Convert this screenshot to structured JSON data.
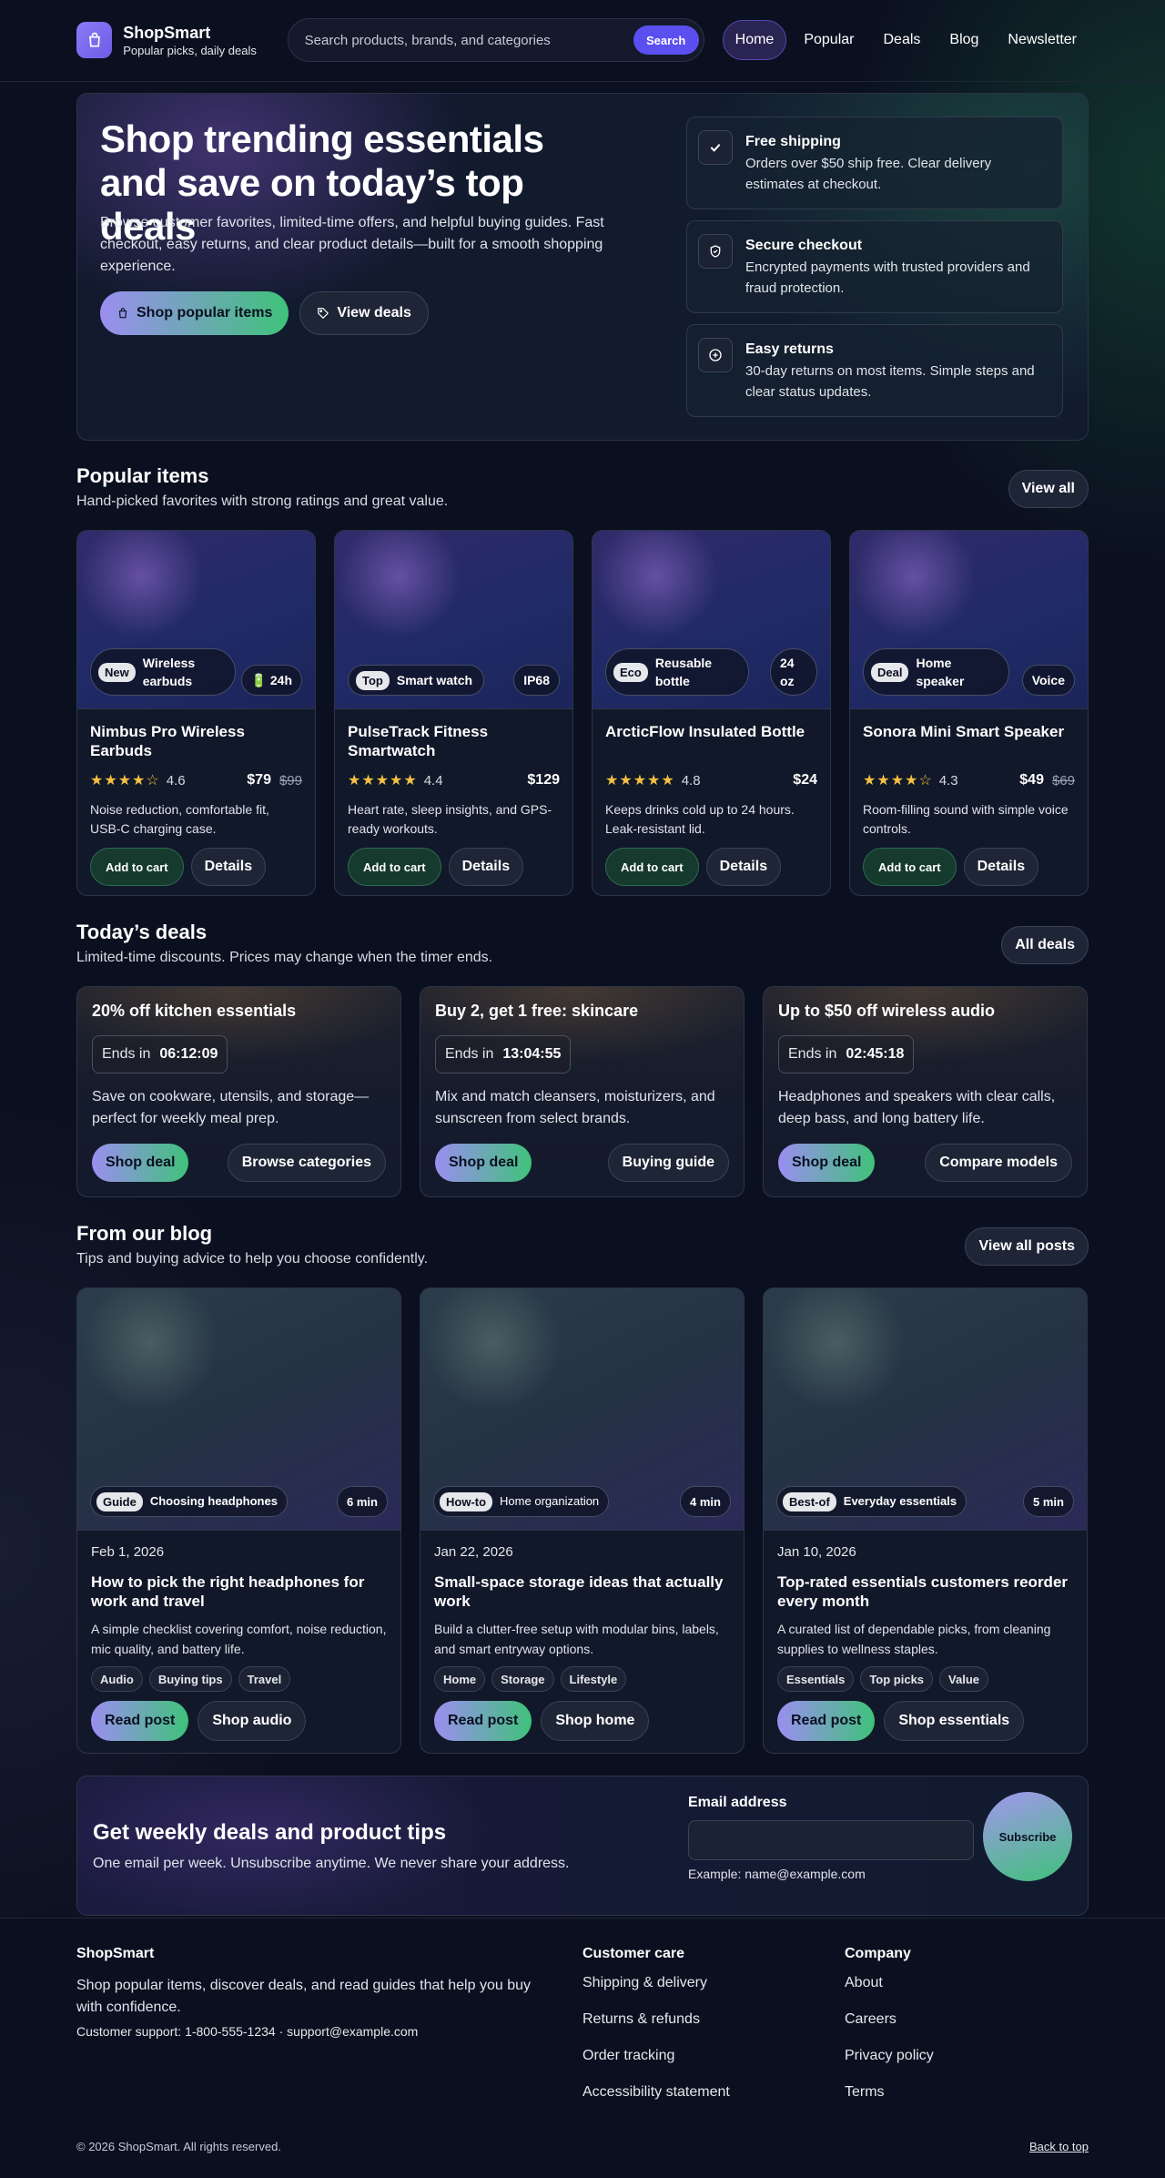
{
  "brand": {
    "name": "ShopSmart",
    "tagline": "Popular picks, daily deals"
  },
  "search": {
    "placeholder": "Search products, brands, and categories",
    "button": "Search"
  },
  "nav": [
    "Home",
    "Popular",
    "Deals",
    "Blog",
    "Newsletter"
  ],
  "hero": {
    "title": "Shop trending essentials and save on today’s top deals",
    "text": "Browse customer favorites, limited-time offers, and helpful buying guides. Fast checkout, easy returns, and clear product details—built for a smooth shopping experience.",
    "primary": "Shop popular items",
    "secondary": "View deals",
    "features": [
      {
        "title": "Free shipping",
        "text": "Orders over $50 ship free. Clear delivery estimates at checkout.",
        "icon": "check-icon"
      },
      {
        "title": "Secure checkout",
        "text": "Encrypted payments with trusted providers and fraud protection.",
        "icon": "shield-icon"
      },
      {
        "title": "Easy returns",
        "text": "30-day returns on most items. Simple steps and clear status updates.",
        "icon": "return-icon"
      }
    ]
  },
  "popular": {
    "title": "Popular items",
    "subtitle": "Hand-picked favorites with strong ratings and great value.",
    "view_all": "View all",
    "add_label": "Add to cart",
    "details_label": "Details",
    "items": [
      {
        "badge": "New",
        "tag": "Wireless earbuds",
        "chip": "🔋 24h",
        "name": "Nimbus Pro Wireless Earbuds",
        "stars": "★★★★☆",
        "rating": "4.6",
        "price": "$79",
        "old": "$99",
        "desc": "Noise reduction, comfortable fit, USB-C charging case."
      },
      {
        "badge": "Top",
        "tag": "Smart watch",
        "chip": "IP68",
        "name": "PulseTrack Fitness Smartwatch",
        "stars": "★★★★★",
        "rating": "4.4",
        "price": "$129",
        "old": "",
        "desc": "Heart rate, sleep insights, and GPS-ready workouts."
      },
      {
        "badge": "Eco",
        "tag": "Reusable bottle",
        "chip": "24 oz",
        "name": "ArcticFlow Insulated Bottle",
        "stars": "★★★★★",
        "rating": "4.8",
        "price": "$24",
        "old": "",
        "desc": "Keeps drinks cold up to 24 hours. Leak-resistant lid."
      },
      {
        "badge": "Deal",
        "tag": "Home speaker",
        "chip": "Voice",
        "name": "Sonora Mini Smart Speaker",
        "stars": "★★★★☆",
        "rating": "4.3",
        "price": "$49",
        "old": "$69",
        "desc": "Room-filling sound with simple voice controls."
      }
    ]
  },
  "deals": {
    "title": "Today’s deals",
    "subtitle": "Limited-time discounts. Prices may change when the timer ends.",
    "all": "All deals",
    "ends_label": "Ends in",
    "shop_label": "Shop deal",
    "items": [
      {
        "title": "20% off kitchen essentials",
        "timer": "06:12:09",
        "text": "Save on cookware, utensils, and storage—perfect for weekly meal prep.",
        "secondary": "Browse categories"
      },
      {
        "title": "Buy 2, get 1 free: skincare",
        "timer": "13:04:55",
        "text": "Mix and match cleansers, moisturizers, and sunscreen from select brands.",
        "secondary": "Buying guide"
      },
      {
        "title": "Up to $50 off wireless audio",
        "timer": "02:45:18",
        "text": "Headphones and speakers with clear calls, deep bass, and long battery life.",
        "secondary": "Compare models"
      }
    ]
  },
  "blog": {
    "title": "From our blog",
    "subtitle": "Tips and buying advice to help you choose confidently.",
    "all": "View all posts",
    "read_label": "Read post",
    "posts": [
      {
        "badge": "Guide",
        "tag": "Choosing headphones",
        "time": "6 min",
        "date": "Feb 1, 2026",
        "title": "How to pick the right headphones for work and travel",
        "text": "A simple checklist covering comfort, noise reduction, mic quality, and battery life.",
        "tags": [
          "Audio",
          "Buying tips",
          "Travel"
        ],
        "secondary": "Shop audio"
      },
      {
        "badge": "How-to",
        "tag": "Home organization",
        "time": "4 min",
        "date": "Jan 22, 2026",
        "title": "Small-space storage ideas that actually work",
        "text": "Build a clutter-free setup with modular bins, labels, and smart entryway options.",
        "tags": [
          "Home",
          "Storage",
          "Lifestyle"
        ],
        "secondary": "Shop home"
      },
      {
        "badge": "Best-of",
        "tag": "Everyday essentials",
        "time": "5 min",
        "date": "Jan 10, 2026",
        "title": "Top-rated essentials customers reorder every month",
        "text": "A curated list of dependable picks, from cleaning supplies to wellness staples.",
        "tags": [
          "Essentials",
          "Top picks",
          "Value"
        ],
        "secondary": "Shop essentials"
      }
    ]
  },
  "newsletter": {
    "title": "Get weekly deals and product tips",
    "subtitle": "One email per week. Unsubscribe anytime. We never share your address.",
    "label": "Email address",
    "example": "Example: name@example.com",
    "button": "Subscribe",
    "value": ""
  },
  "footer": {
    "brand": "ShopSmart",
    "text": "Shop popular items, discover deals, and read guides that help you buy with confidence.",
    "support_label": "Customer support:",
    "phone": "1-800-555-1234",
    "sep": " · ",
    "email": "support@example.com",
    "care_title": "Customer care",
    "care": [
      "Shipping & delivery",
      "Returns & refunds",
      "Order tracking",
      "Accessibility statement"
    ],
    "company_title": "Company",
    "company": [
      "About",
      "Careers",
      "Privacy policy",
      "Terms"
    ],
    "copyright": "© 2026 ShopSmart. All rights reserved.",
    "back_to_top": "Back to top"
  },
  "colors": {
    "bg": "#0b1020",
    "accent": "#5b4ff0",
    "gradient_start": "#9b8ef0",
    "gradient_end": "#3fc27a",
    "star": "#f5c042"
  }
}
